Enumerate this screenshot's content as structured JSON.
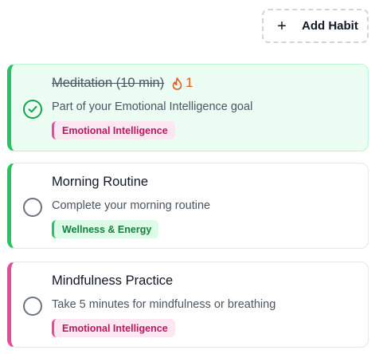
{
  "header": {
    "add_habit_label": "Add Habit",
    "add_habit_icon": "plus-icon"
  },
  "habits": [
    {
      "title": "Meditation (10 min)",
      "completed": true,
      "streak": "1",
      "streak_icon": "flame-icon",
      "description": "Part of your Emotional Intelligence goal",
      "tag": "Emotional Intelligence",
      "tag_color": "#be185d",
      "accent_color": "#22c55e"
    },
    {
      "title": "Morning Routine",
      "completed": false,
      "description": "Complete your morning routine",
      "tag": "Wellness & Energy",
      "tag_color": "#15803d",
      "accent_color": "#22c55e"
    },
    {
      "title": "Mindfulness Practice",
      "completed": false,
      "description": "Take 5 minutes for mindfulness or breathing",
      "tag": "Emotional Intelligence",
      "tag_color": "#be185d",
      "accent_color": "#ec4899"
    }
  ]
}
